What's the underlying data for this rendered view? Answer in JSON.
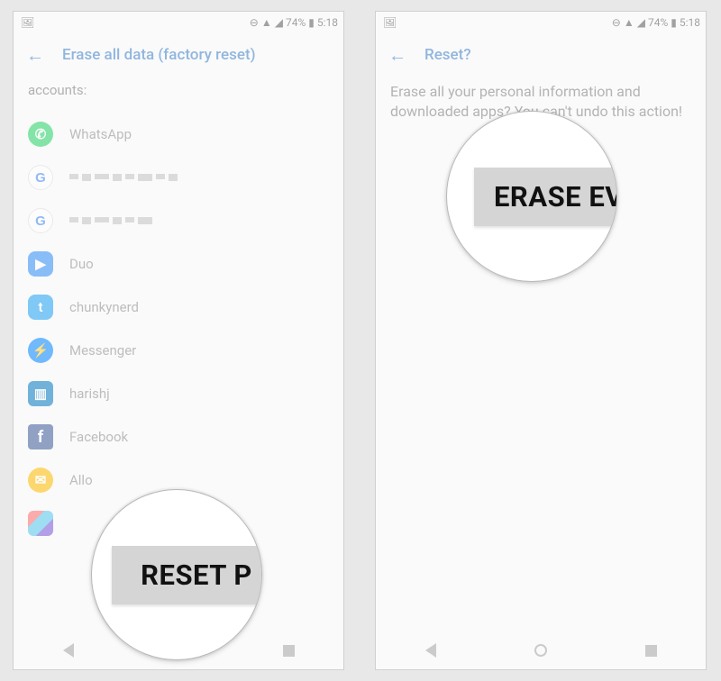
{
  "status": {
    "battery_pct": "74%",
    "time": "5:18"
  },
  "screenA": {
    "title": "Erase all data (factory reset)",
    "subheading": "accounts:",
    "accounts": [
      {
        "label": "WhatsApp",
        "icon": "whatsapp-icon"
      },
      {
        "label": "",
        "icon": "google-icon",
        "redacted": true
      },
      {
        "label": "",
        "icon": "google-icon",
        "redacted": true
      },
      {
        "label": "Duo",
        "icon": "duo-icon"
      },
      {
        "label": "chunkynerd",
        "icon": "twitter-icon"
      },
      {
        "label": "Messenger",
        "icon": "messenger-icon"
      },
      {
        "label": "harishj",
        "icon": "trello-icon"
      },
      {
        "label": "Facebook",
        "icon": "facebook-icon"
      },
      {
        "label": "Allo",
        "icon": "allo-icon"
      },
      {
        "label": "",
        "icon": "other-icon"
      }
    ],
    "magnified_button": "RESET P"
  },
  "screenB": {
    "title": "Reset?",
    "body": "Erase all your personal information and downloaded apps? You can't undo this action!",
    "magnified_button": "ERASE EV"
  }
}
